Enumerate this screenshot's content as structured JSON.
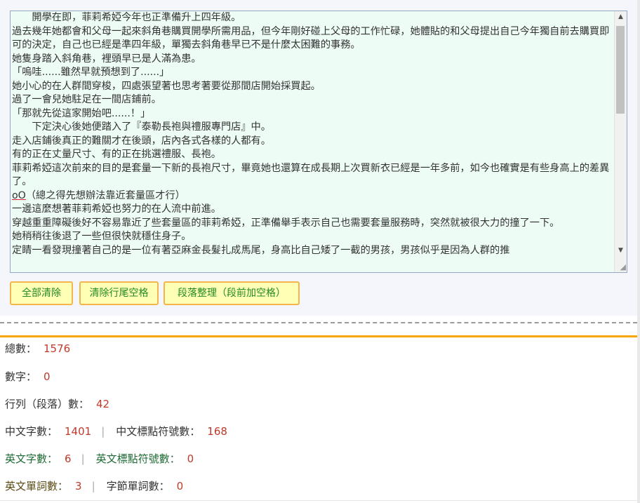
{
  "editor": {
    "lines": [
      "　　開學在即，菲莉希婭今年也正準備升上四年級。",
      "過去幾年她都會和父母一起來斜角巷購買開學所需用品，但今年剛好碰上父母的工作忙碌，她體貼的和父母提出自己今年獨自前去購買即可的決定，自己也已經是準四年級，單獨去斜角巷早已不是什麼太困難的事務。",
      "她隻身踏入斜角巷，裡頭早已是人滿為患。",
      "「嗚哇......雖然早就預想到了......」",
      "她小心的在人群間穿梭，四處張望著也思考著要從那間店開始採買起。",
      "過了一會兒她駐足在一間店鋪前。",
      "「那就先從這家開始吧......！」",
      "　　下定決心後她便踏入了『泰勒長袍與禮服專門店』中。",
      "走入店鋪後真正的難關才在後頭，店內各式各樣的人都有。",
      "有的正在丈量尺寸、有的正在挑選禮服、長袍。",
      "菲莉希婭這次前來的目的是套量一下新的長袍尺寸，畢竟她也還算在成長期上次買新衣已經是一年多前，如今也確實是有些身高上的差異了。",
      "（總之得先想辦法靠近套量區才行）",
      "一邊這麼想著菲莉希婭也努力的在人流中前進。",
      "穿越重重障礙後好不容易靠近了些套量區的菲莉希婭，正準備舉手表示自己也需要套量服務時，突然就被很大力的撞了一下。",
      "她稍稍往後退了一些但很快就穩住身子。",
      "定睛一看發現撞著自己的是一位有著亞麻金長髮扎成馬尾，身高比自己矮了一截的男孩，男孩似乎是因為人群的推"
    ],
    "emoticon": "oO"
  },
  "buttons": {
    "clear_all": "全部清除",
    "trim_trailing": "清除行尾空格",
    "paragraph_format": "段落整理（段前加空格）"
  },
  "stats": {
    "total_label": "總數：",
    "total_value": "1576",
    "digits_label": "數字：",
    "digits_value": "0",
    "lines_label": "行列（段落）數：",
    "lines_value": "42",
    "chinese_chars_label": "中文字數：",
    "chinese_chars_value": "1401",
    "chinese_punct_label": "中文標點符號數：",
    "chinese_punct_value": "168",
    "english_chars_label": "英文字數：",
    "english_chars_value": "6",
    "english_punct_label": "英文標點符號數：",
    "english_punct_value": "0",
    "english_words_label": "英文單詞數：",
    "english_words_value": "3",
    "byte_words_label": "字節單詞數：",
    "byte_words_value": "0",
    "separator": "|"
  }
}
